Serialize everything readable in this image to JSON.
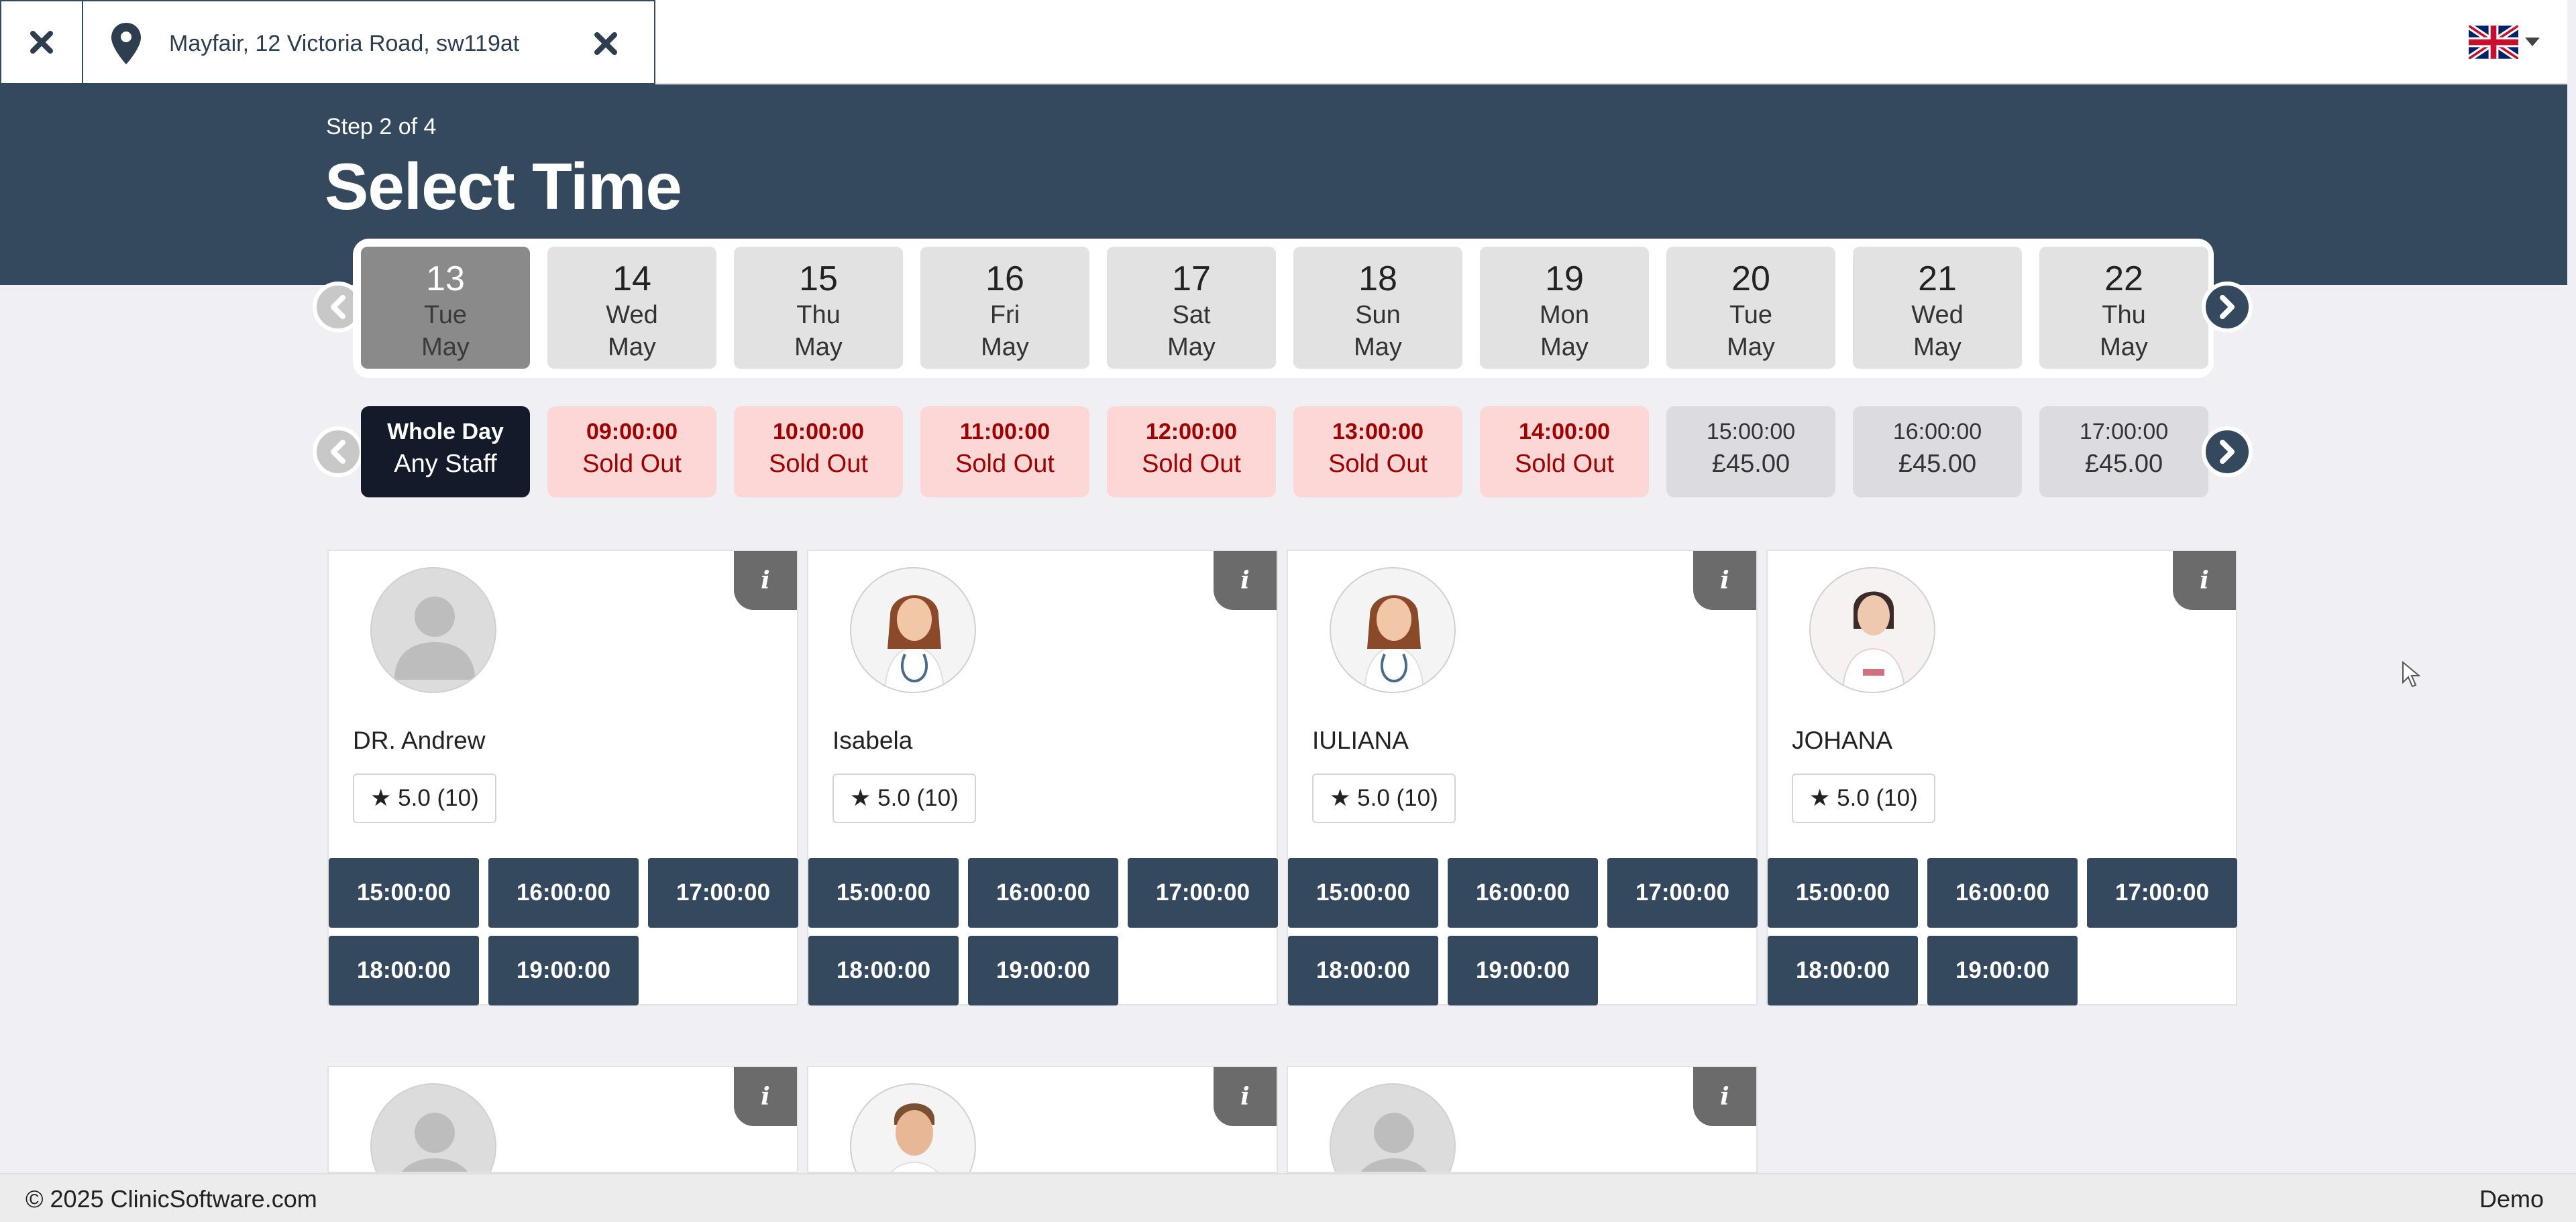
{
  "topbar": {
    "address": "Mayfair, 12 Victoria Road, sw119at"
  },
  "header": {
    "step": "Step 2 of 4",
    "title": "Select Time"
  },
  "dates": [
    {
      "day": "13",
      "weekday": "Tue",
      "month": "May",
      "selected": true
    },
    {
      "day": "14",
      "weekday": "Wed",
      "month": "May"
    },
    {
      "day": "15",
      "weekday": "Thu",
      "month": "May"
    },
    {
      "day": "16",
      "weekday": "Fri",
      "month": "May"
    },
    {
      "day": "17",
      "weekday": "Sat",
      "month": "May"
    },
    {
      "day": "18",
      "weekday": "Sun",
      "month": "May"
    },
    {
      "day": "19",
      "weekday": "Mon",
      "month": "May"
    },
    {
      "day": "20",
      "weekday": "Tue",
      "month": "May"
    },
    {
      "day": "21",
      "weekday": "Wed",
      "month": "May"
    },
    {
      "day": "22",
      "weekday": "Thu",
      "month": "May"
    }
  ],
  "times": [
    {
      "line1": "Whole Day",
      "line2": "Any Staff",
      "state": "whole"
    },
    {
      "line1": "09:00:00",
      "line2": "Sold Out",
      "state": "sold"
    },
    {
      "line1": "10:00:00",
      "line2": "Sold Out",
      "state": "sold"
    },
    {
      "line1": "11:00:00",
      "line2": "Sold Out",
      "state": "sold"
    },
    {
      "line1": "12:00:00",
      "line2": "Sold Out",
      "state": "sold"
    },
    {
      "line1": "13:00:00",
      "line2": "Sold Out",
      "state": "sold"
    },
    {
      "line1": "14:00:00",
      "line2": "Sold Out",
      "state": "sold"
    },
    {
      "line1": "15:00:00",
      "line2": "£45.00",
      "state": "avail"
    },
    {
      "line1": "16:00:00",
      "line2": "£45.00",
      "state": "avail"
    },
    {
      "line1": "17:00:00",
      "line2": "£45.00",
      "state": "avail"
    }
  ],
  "staff": [
    {
      "name": "DR. Andrew",
      "rating": "5.0 (10)",
      "avatar": "placeholder",
      "slots": [
        "15:00:00",
        "16:00:00",
        "17:00:00",
        "18:00:00",
        "19:00:00"
      ]
    },
    {
      "name": "Isabela",
      "rating": "5.0 (10)",
      "avatar": "doctor-woman",
      "slots": [
        "15:00:00",
        "16:00:00",
        "17:00:00",
        "18:00:00",
        "19:00:00"
      ]
    },
    {
      "name": "IULIANA",
      "rating": "5.0 (10)",
      "avatar": "doctor-woman",
      "slots": [
        "15:00:00",
        "16:00:00",
        "17:00:00",
        "18:00:00",
        "19:00:00"
      ]
    },
    {
      "name": "JOHANA",
      "rating": "5.0 (10)",
      "avatar": "nurse-woman",
      "slots": [
        "15:00:00",
        "16:00:00",
        "17:00:00",
        "18:00:00",
        "19:00:00"
      ]
    }
  ],
  "staff_row2": [
    {
      "avatar": "placeholder"
    },
    {
      "avatar": "doctor-man"
    },
    {
      "avatar": "placeholder"
    }
  ],
  "info_label": "i",
  "footer": {
    "copyright": "© 2025 ClinicSoftware.com",
    "mode": "Demo"
  },
  "colors": {
    "primary": "#34495e",
    "sold_bg": "#fdd6d6",
    "sold_text": "#a10000",
    "selected_date": "#8a8a8a",
    "whole_day": "#131b2b"
  }
}
